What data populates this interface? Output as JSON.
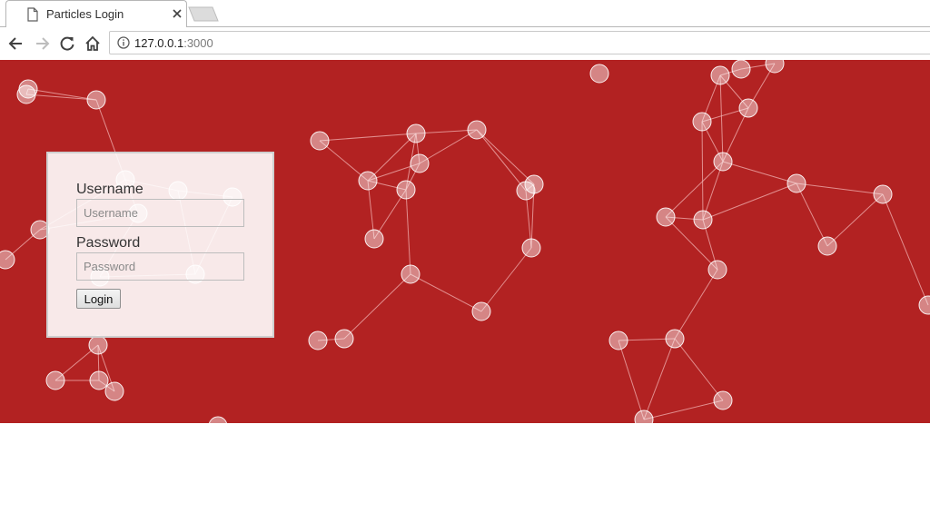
{
  "browser": {
    "tab_title": "Particles Login",
    "url_host": "127.0.0.1",
    "url_port": ":3000",
    "icons": {
      "tab": "document-icon",
      "close": "close-icon",
      "back": "arrow-left-icon",
      "forward": "arrow-right-icon",
      "reload": "reload-icon",
      "home": "home-icon",
      "info": "info-icon"
    }
  },
  "page": {
    "background_color": "#b22222",
    "username_label": "Username",
    "username_placeholder": "Username",
    "username_value": "",
    "password_label": "Password",
    "password_placeholder": "Password",
    "password_value": "",
    "login_label": "Login"
  }
}
